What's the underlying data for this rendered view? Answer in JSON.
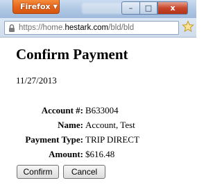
{
  "browser": {
    "menu_button_label": "Firefox",
    "menu_arrow": "▼",
    "window_controls": {
      "minimize_glyph": "–",
      "maximize_glyph": "□",
      "close_glyph": "x"
    },
    "url": {
      "prefix": "https://home.",
      "domain": "hestark.com",
      "path": "/bld/bld"
    }
  },
  "page": {
    "title": "Confirm Payment",
    "date": "11/27/2013",
    "fields": [
      {
        "label": "Account #:",
        "value": "B633004"
      },
      {
        "label": "Name:",
        "value": "Account, Test"
      },
      {
        "label": "Payment Type:",
        "value": "TRIP DIRECT"
      },
      {
        "label": "Amount:",
        "value": "$616.48"
      }
    ],
    "buttons": {
      "confirm_label": "Confirm",
      "cancel_label": "Cancel"
    }
  },
  "colors": {
    "firefox_orange": "#e5631a",
    "titlebar_blue": "#aec6e3",
    "close_red": "#c7472c"
  }
}
